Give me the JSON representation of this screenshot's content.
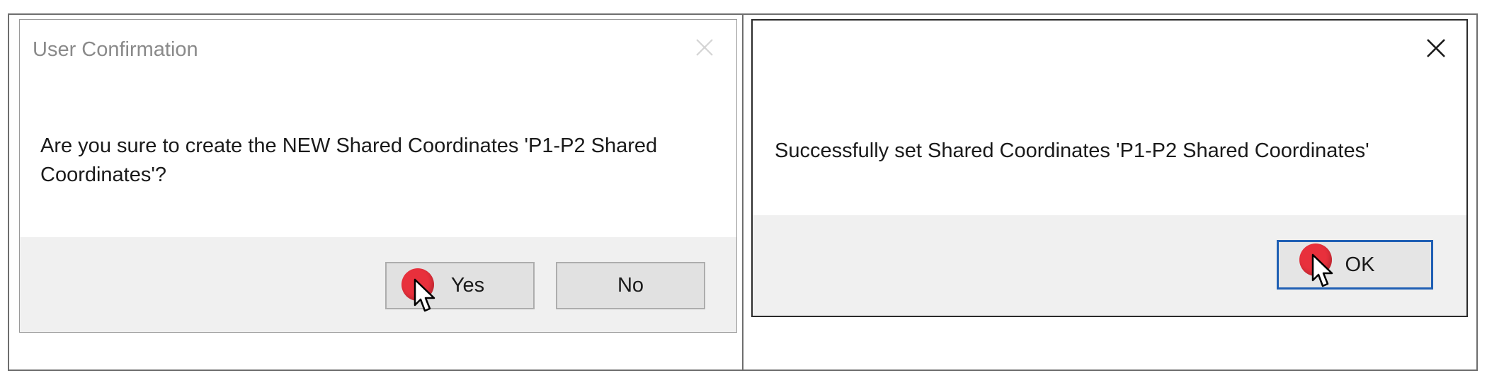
{
  "left_dialog": {
    "title": "User Confirmation",
    "message": "Are you sure to create the NEW Shared Coordinates 'P1-P2 Shared Coordinates'?",
    "yes_label": "Yes",
    "no_label": "No"
  },
  "right_dialog": {
    "message": "Successfully set Shared Coordinates 'P1-P2 Shared Coordinates'",
    "ok_label": "OK"
  },
  "colors": {
    "cursor_highlight": "#e8303c",
    "focus_border": "#1f5fb4",
    "footer_bg": "#f0f0f0"
  },
  "icons": [
    "close-icon",
    "pointer-cursor-icon"
  ]
}
